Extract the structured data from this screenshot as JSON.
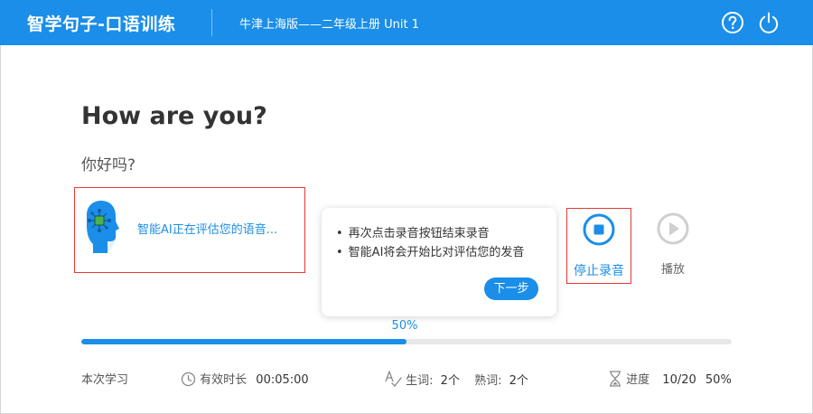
{
  "header": {
    "app_title": "智学句子-口语训练",
    "course_title": "牛津上海版——二年级上册 Unit 1",
    "help_icon": "help-circle-icon",
    "power_icon": "power-icon"
  },
  "sentence": {
    "english": "How are you?",
    "chinese": "你好吗?"
  },
  "ai_status": {
    "icon": "ai-head-icon",
    "text": "智能AI正在评估您的语音..."
  },
  "tooltip": {
    "items": [
      "再次点击录音按钮结束录音",
      "智能AI将会开始比对评估您的发音"
    ],
    "next_label": "下一步"
  },
  "controls": {
    "stop_label": "停止录音",
    "play_label": "播放"
  },
  "progress": {
    "percent_label": "50%",
    "fraction": 0.5
  },
  "stats": {
    "session_label": "本次学习",
    "duration_label": "有效时长",
    "duration_value": "00:05:00",
    "new_words_label": "生词:",
    "new_words_value": "2个",
    "known_words_label": "熟词:",
    "known_words_value": "2个",
    "progress_label": "进度",
    "progress_value": "10/20",
    "progress_percent": "50%"
  },
  "colors": {
    "accent": "#1a8ee8",
    "highlight_border": "#e53935"
  }
}
